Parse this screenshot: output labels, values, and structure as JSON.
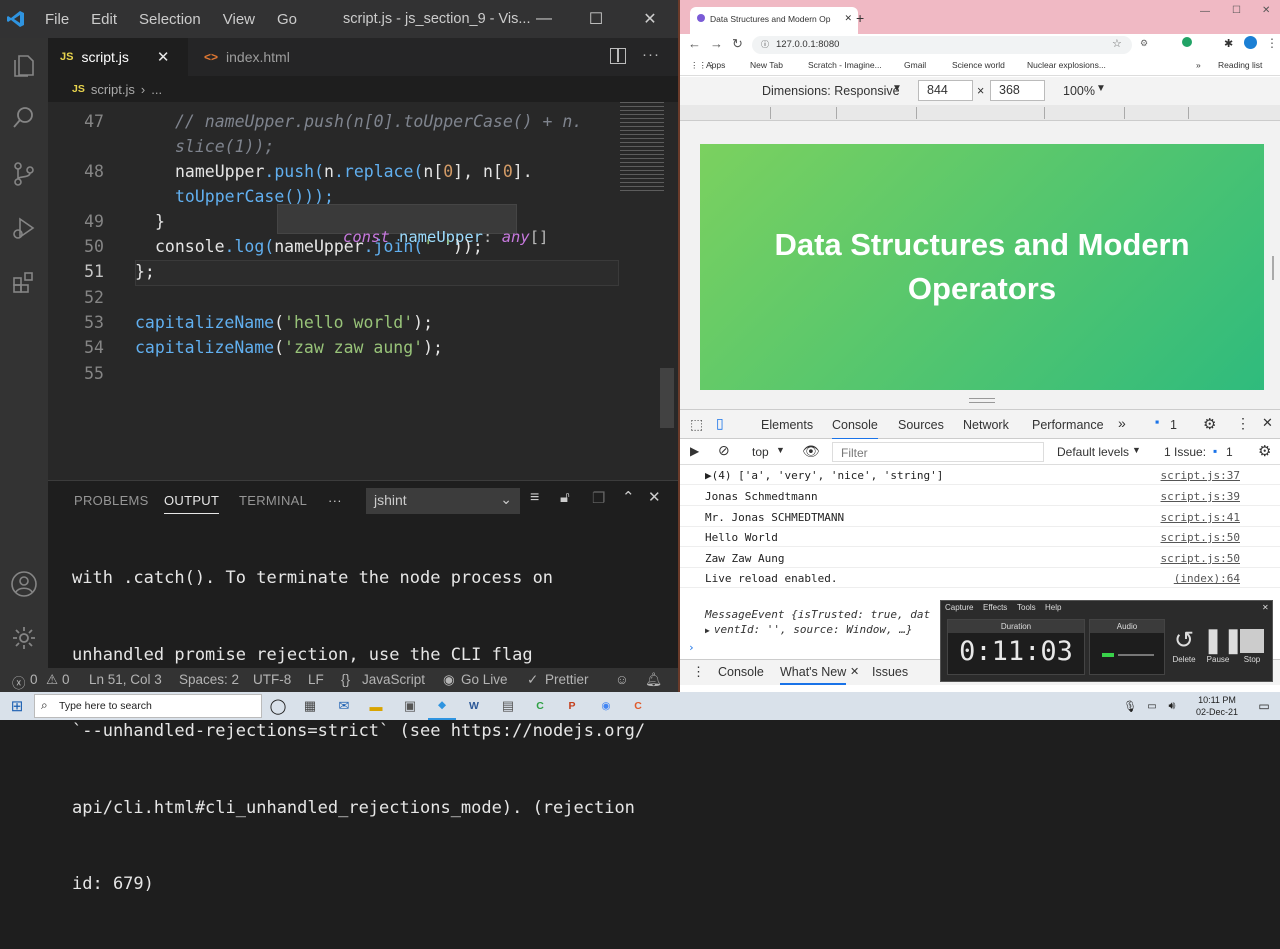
{
  "vscode": {
    "title": "script.js - js_section_9 - Vis...",
    "menu": [
      "File",
      "Edit",
      "Selection",
      "View",
      "Go"
    ],
    "tabs": [
      {
        "label": "script.js",
        "badge": "JS",
        "active": true
      },
      {
        "label": "index.html",
        "badge": "<>",
        "active": false
      }
    ],
    "breadcrumb": {
      "badge": "JS",
      "file": "script.js",
      "more": "..."
    },
    "line_numbers": [
      "47",
      "48",
      "49",
      "50",
      "51",
      "52",
      "53",
      "54",
      "55"
    ],
    "code": {
      "l47a": "// nameUpper.push(n[0].toUpperCase() + n.",
      "l47b": "slice(1));",
      "l48a_var": "nameUpper",
      "l48a_push": ".push(",
      "l48a_n": "n",
      "l48a_replace": ".replace(",
      "l48a_args": "n[",
      "l48a_zero": "0",
      "l48a_rest": "], n[",
      "l48a_zero2": "0",
      "l48a_end": "].",
      "l48b": "toUpperCase()));",
      "l49": "}",
      "l50_console": "console",
      "l50_log": ".log(",
      "l50_var": "nameUpper",
      "l50_join": ".join(",
      "l50_str": "' '",
      "l50_end": "));",
      "l51": "};",
      "l53_fn": "capitalizeName",
      "l53_str": "'hello world'",
      "l54_fn": "capitalizeName",
      "l54_str": "'zaw zaw aung'",
      "paren_open": "(",
      "paren_close": ");"
    },
    "hover": {
      "kw": "const",
      "name": "nameUpper",
      "colon": ":",
      "type": "any",
      "brackets": "[]"
    },
    "panel": {
      "tabs": [
        "PROBLEMS",
        "OUTPUT",
        "TERMINAL",
        "···"
      ],
      "active_tab": "OUTPUT",
      "channel": "jshint",
      "output_lines": [
        "with .catch(). To terminate the node process on",
        "unhandled promise rejection, use the CLI flag",
        "`--unhandled-rejections=strict` (see https://nodejs.org/",
        "api/cli.html#cli_unhandled_rejections_mode). (rejection",
        "id: 679)"
      ]
    },
    "status": {
      "errors": "0",
      "warnings": "0",
      "position": "Ln 51, Col 3",
      "spaces": "Spaces: 2",
      "encoding": "UTF-8",
      "eol": "LF",
      "language": "JavaScript",
      "golive": "Go Live",
      "prettier": "Prettier"
    }
  },
  "browser": {
    "tab_title": "Data Structures and Modern Op",
    "url": "127.0.0.1:8080",
    "bookmarks": [
      "Apps",
      "New Tab",
      "Scratch - Imagine...",
      "Gmail",
      "Science world",
      "Nuclear explosions...",
      "Reading list"
    ],
    "devbar": {
      "dimensions": "Dimensions: Responsive",
      "width": "844",
      "times": "×",
      "height": "368",
      "zoom": "100%"
    },
    "hero_title": "Data Structures and Modern Operators",
    "devtools_tabs": [
      "Elements",
      "Console",
      "Sources",
      "Network",
      "Performance"
    ],
    "active_devtools_tab": "Console",
    "issues_count": "1",
    "context": "top",
    "filter_placeholder": "Filter",
    "levels": "Default levels",
    "issue_label": "1 Issue:",
    "issue_num": "1",
    "console": [
      {
        "msg": "▶(4) ['a', 'very', 'nice', 'string']",
        "src": "script.js:37"
      },
      {
        "msg": "Jonas Schmedtmann",
        "src": "script.js:39"
      },
      {
        "msg": "Mr. Jonas SCHMEDTMANN",
        "src": "script.js:41"
      },
      {
        "msg": "Hello World",
        "src": "script.js:50"
      },
      {
        "msg": "Zaw Zaw Aung",
        "src": "script.js:50"
      },
      {
        "msg": "Live reload enabled.",
        "src": "(index):64"
      }
    ],
    "message_event": "MessageEvent {isTrusted: true, dat",
    "message_event2": "ventId: '', source: Window, …}",
    "drawer_tabs": [
      "Console",
      "What's New",
      "Issues"
    ]
  },
  "recorder": {
    "menu": [
      "Capture",
      "Effects",
      "Tools",
      "Help"
    ],
    "duration_label": "Duration",
    "audio_label": "Audio",
    "time": "0:11:03",
    "buttons": [
      "Delete",
      "Pause",
      "Stop"
    ]
  },
  "taskbar": {
    "search_placeholder": "Type here to search",
    "time": "10:11 PM",
    "date": "02-Dec-21"
  }
}
